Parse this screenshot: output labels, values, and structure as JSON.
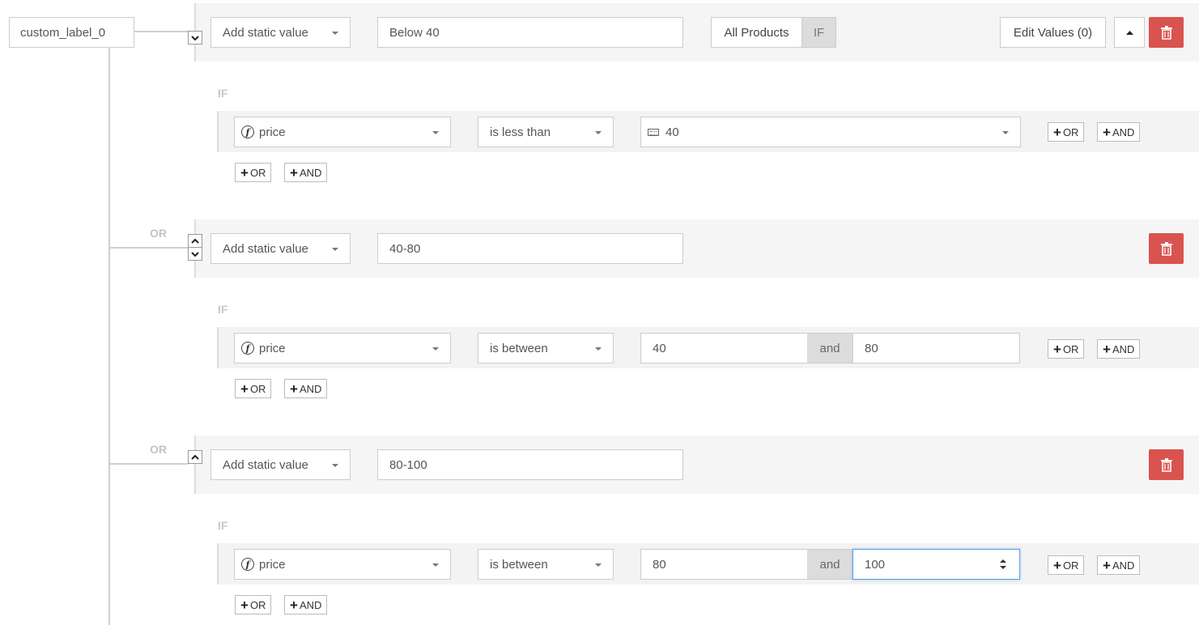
{
  "root": {
    "label": "custom_label_0"
  },
  "connector_label": "OR",
  "if_label": "IF",
  "common": {
    "value_type": "Add static value",
    "field": "price",
    "and_word": "and",
    "add_or": "OR",
    "add_and": "AND"
  },
  "rules": [
    {
      "value": "Below 40",
      "scope_all": "All Products",
      "scope_if": "IF",
      "edit_values": "Edit Values (0)",
      "operator": "is less than",
      "operand": "40"
    },
    {
      "value": "40-80",
      "operator": "is between",
      "from": "40",
      "to": "80"
    },
    {
      "value": "80-100",
      "operator": "is between",
      "from": "80",
      "to": "100"
    }
  ],
  "colors": {
    "danger": "#d9534f",
    "focus": "#5b9bf0",
    "band": "#f5f5f5"
  }
}
